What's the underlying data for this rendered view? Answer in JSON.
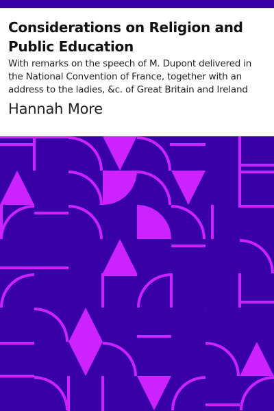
{
  "cover": {
    "title": "Considerations on Religion and Public Education",
    "subtitle": "With remarks on the speech of M. Dupont delivered in the National Convention of France, together with an address to the ladies, &c. of Great Britain and Ireland",
    "author": "Hannah More"
  },
  "colors": {
    "background_pattern": "#3a00a8",
    "shape_color": "#cc22ff",
    "header_background": "#ffffff"
  }
}
